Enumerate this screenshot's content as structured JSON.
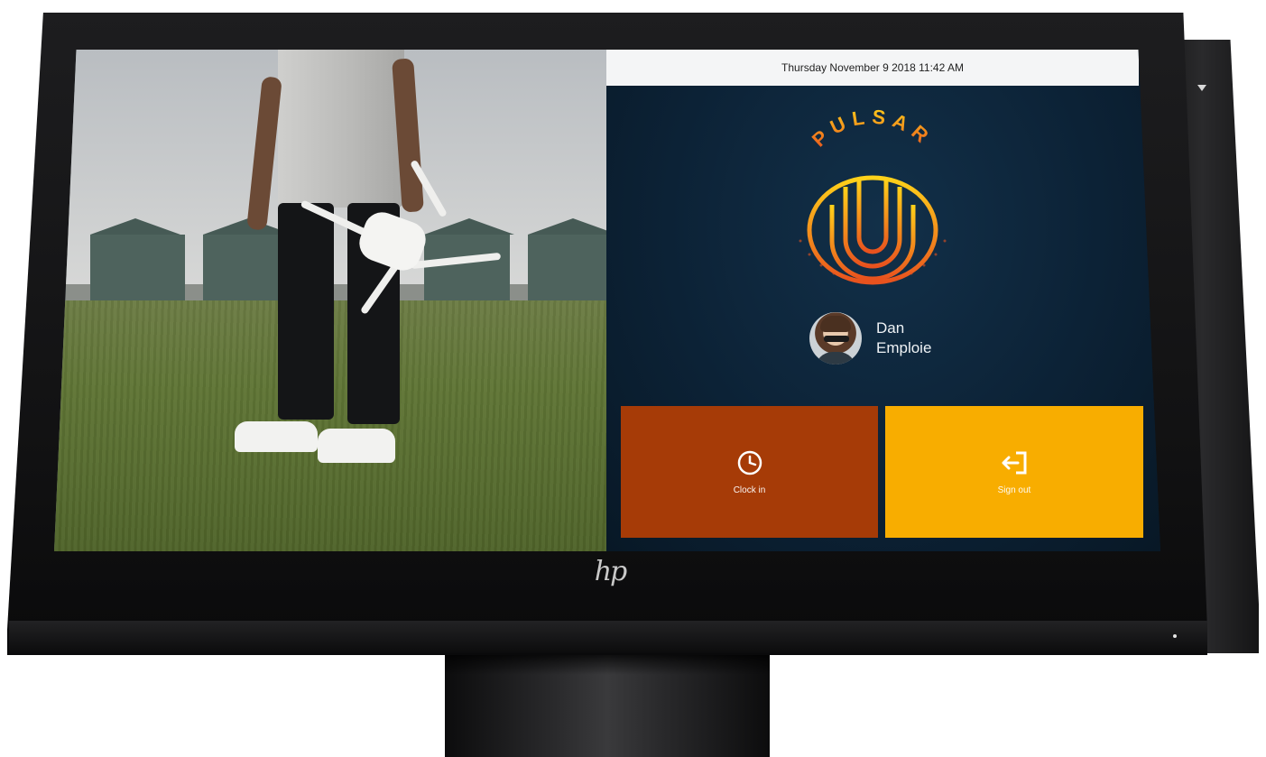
{
  "device": {
    "brand_logo": "hp"
  },
  "kiosk": {
    "datetime": "Thursday November 9 2018 11:42 AM",
    "logo": {
      "brand": "PULSAR"
    },
    "user": {
      "first_name": "Dan",
      "last_name": "Emploie"
    },
    "actions": {
      "clock_in_label": "Clock in",
      "sign_out_label": "Sign out",
      "clock_in_icon": "clock-icon",
      "sign_out_icon": "sign-out-icon"
    },
    "colors": {
      "panel_background": "#0c2236",
      "date_bar": "#f4f5f6",
      "clock_in_tile": "#a63b07",
      "sign_out_tile": "#f8ad00",
      "logo_gradient_start": "#ffd21a",
      "logo_gradient_end": "#e8521e"
    }
  }
}
